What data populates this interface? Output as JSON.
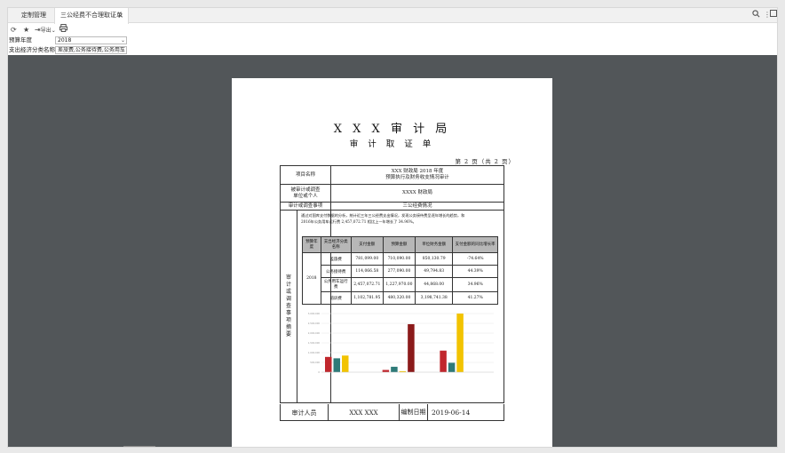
{
  "tabs": [
    {
      "label": "定制管理"
    },
    {
      "label": "三公经费不合理取证单"
    }
  ],
  "toolbar": {
    "export_label": "导出"
  },
  "filters": {
    "year": {
      "label": "预算年度",
      "value": "2018"
    },
    "category": {
      "label": "支出经济分类名称",
      "value": "差旅费,公务接待费,公务用车"
    }
  },
  "document": {
    "title": "X X X 审 计 局",
    "subtitle": "审 计 取 证 单",
    "page_info": "第  2  页（共  2 页）",
    "rows": {
      "project_label": "项目名称",
      "project_value_1": "XXX 财政局 2018 年度",
      "project_value_2": "预算执行及财务收支情况审计",
      "audited_label_1": "被审计或调查",
      "audited_label_2": "单位或个人",
      "audited_value": "XXXX 财政局",
      "matter_label": "审计或调查事项",
      "matter_value": "三公经费情况",
      "summary_label": "审计或调查事项摘要"
    },
    "summary_text": "通过对国库支付数据的分析，统计近三年三公经费支出情况，发现公务接待费呈逐年增长的趋势，和2016年公务用车运行费 2,457,072.71 相比上一年增长了 34.96%。",
    "table": {
      "headers": [
        "预算年度",
        "支出经济分类名称",
        "支付金额",
        "预算金额",
        "单位财务金额",
        "支付金额的同比增长率"
      ],
      "year": "2018",
      "rows": [
        [
          "差旅费",
          "781,099.00",
          "710,090.00",
          "850,130.79",
          "-74.64%"
        ],
        [
          "公务接待费",
          "114,066.58",
          "277,090.00",
          "49,794.83",
          "44.39%"
        ],
        [
          "公务用车运行费",
          "2,457,072.71",
          "1,227,970.00",
          "44,868.00",
          "34.96%"
        ],
        [
          "培训费",
          "1,102,781.95",
          "480,320.00",
          "3,198,741.38",
          "41.27%"
        ]
      ]
    },
    "signature": {
      "auditor_label": "审计人员",
      "auditor_names": "XXX    XXX",
      "date_label": "编制日期",
      "date_value": "2019-06-14"
    }
  },
  "chart_data": {
    "type": "bar",
    "categories": [
      "",
      "",
      ""
    ],
    "yticks": [
      "0",
      "500,000",
      "1,000,000",
      "1,500,000",
      "2,000,000",
      "2,500,000",
      "3,000,000"
    ],
    "ylim": [
      0,
      3000000
    ],
    "series": [
      {
        "color": "#c0272d",
        "values": [
          781099,
          114066,
          1102781
        ]
      },
      {
        "color": "#2e7a78",
        "values": [
          710090,
          277090,
          480320
        ]
      },
      {
        "color": "#f2c300",
        "values": [
          850130,
          49794,
          3198741
        ]
      },
      {
        "color": "#8b1a1a",
        "values": [
          0,
          2457072,
          0
        ]
      }
    ],
    "colors": {
      "red": "#c0272d",
      "teal": "#2e7a78",
      "yellow": "#f2c300"
    }
  }
}
